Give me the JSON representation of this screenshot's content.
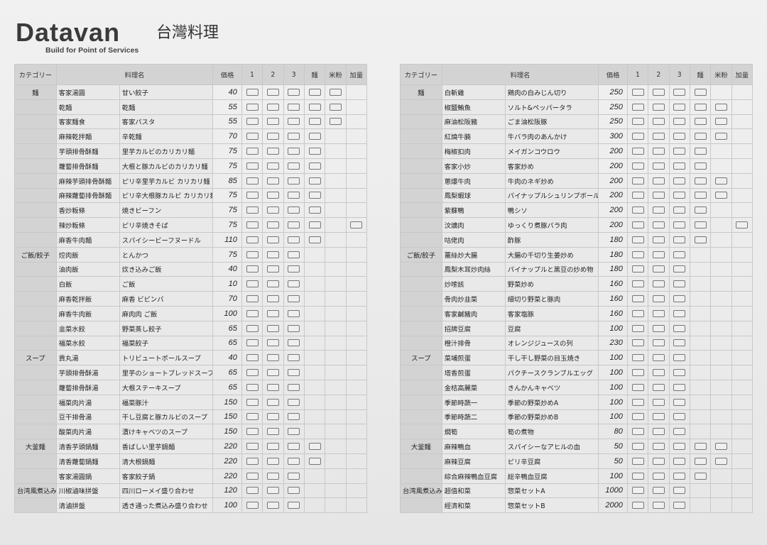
{
  "header": {
    "logo_text": "Datavan",
    "tagline": "Build for Point of Services",
    "title": "台灣料理"
  },
  "columns": {
    "category": "カテゴリー",
    "dish": "料理名",
    "price": "価格",
    "opt1": "1",
    "opt2": "2",
    "opt3": "3",
    "noodle": "麵",
    "rice_noodle": "米粉",
    "extra": "加量"
  },
  "left_table": {
    "rows": [
      {
        "cat": "麵",
        "name": "客家湯圓",
        "desc": "甘い餃子",
        "price": "40",
        "boxes": [
          1,
          1,
          1,
          1,
          1,
          0
        ]
      },
      {
        "cat": "",
        "name": "乾麵",
        "desc": "乾麵",
        "price": "55",
        "boxes": [
          1,
          1,
          1,
          1,
          1,
          0
        ]
      },
      {
        "cat": "",
        "name": "客家麵食",
        "desc": "客家パスタ",
        "price": "55",
        "boxes": [
          1,
          1,
          1,
          1,
          1,
          0
        ]
      },
      {
        "cat": "",
        "name": "麻辣乾拌麵",
        "desc": "辛乾麵",
        "price": "70",
        "boxes": [
          1,
          1,
          1,
          1,
          0,
          0
        ]
      },
      {
        "cat": "",
        "name": "芋頭排骨酥麵",
        "desc": "里芋カルビのカリカリ麺",
        "price": "75",
        "boxes": [
          1,
          1,
          1,
          1,
          0,
          0
        ]
      },
      {
        "cat": "",
        "name": "蘿蔔排骨酥麵",
        "desc": "大根と豚カルビのカリカリ麺",
        "price": "75",
        "boxes": [
          1,
          1,
          1,
          1,
          0,
          0
        ]
      },
      {
        "cat": "",
        "name": "麻辣芋頭排骨酥麵",
        "desc": "ピリ辛里芋カルビ カリカリ麺",
        "price": "85",
        "boxes": [
          1,
          1,
          1,
          1,
          0,
          0
        ]
      },
      {
        "cat": "",
        "name": "麻辣蘿蔔排骨酥麵",
        "desc": "ピリ辛大根豚カルビ カリカリ麺",
        "price": "75",
        "boxes": [
          1,
          1,
          1,
          1,
          0,
          0
        ]
      },
      {
        "cat": "",
        "name": "香炒粄條",
        "desc": "焼きビーフン",
        "price": "75",
        "boxes": [
          1,
          1,
          1,
          1,
          0,
          0
        ]
      },
      {
        "cat": "",
        "name": "辣炒粄條",
        "desc": "ピリ辛焼きそば",
        "price": "75",
        "boxes": [
          1,
          1,
          1,
          1,
          0,
          1
        ]
      },
      {
        "cat": "",
        "name": "麻香牛肉麵",
        "desc": "スパイシービーフヌードル",
        "price": "110",
        "boxes": [
          1,
          1,
          1,
          1,
          0,
          0
        ]
      },
      {
        "cat": "ご飯/餃子",
        "name": "焢肉飯",
        "desc": "とんかつ",
        "price": "75",
        "boxes": [
          1,
          1,
          1,
          0,
          0,
          0
        ]
      },
      {
        "cat": "",
        "name": "油肉飯",
        "desc": "炊き込みご飯",
        "price": "40",
        "boxes": [
          1,
          1,
          1,
          0,
          0,
          0
        ]
      },
      {
        "cat": "",
        "name": "白飯",
        "desc": "ご飯",
        "price": "10",
        "boxes": [
          1,
          1,
          1,
          0,
          0,
          0
        ]
      },
      {
        "cat": "",
        "name": "麻香乾拌飯",
        "desc": "麻香 ビビンバ",
        "price": "70",
        "boxes": [
          1,
          1,
          1,
          0,
          0,
          0
        ]
      },
      {
        "cat": "",
        "name": "麻香牛肉飯",
        "desc": "麻肉肉 ご飯",
        "price": "100",
        "boxes": [
          1,
          1,
          1,
          0,
          0,
          0
        ]
      },
      {
        "cat": "",
        "name": "韭菜水餃",
        "desc": "野菜蒸し餃子",
        "price": "65",
        "boxes": [
          1,
          1,
          1,
          0,
          0,
          0
        ]
      },
      {
        "cat": "",
        "name": "福菜水餃",
        "desc": "福菜餃子",
        "price": "65",
        "boxes": [
          1,
          1,
          1,
          0,
          0,
          0
        ]
      },
      {
        "cat": "スープ",
        "name": "貢丸湯",
        "desc": "トリビュートボールスープ",
        "price": "40",
        "boxes": [
          1,
          1,
          1,
          0,
          0,
          0
        ]
      },
      {
        "cat": "",
        "name": "芋頭排骨酥湯",
        "desc": "里芋のショートブレッドスープ",
        "price": "65",
        "boxes": [
          1,
          1,
          1,
          0,
          0,
          0
        ]
      },
      {
        "cat": "",
        "name": "蘿蔔排骨酥湯",
        "desc": "大根ステーキスープ",
        "price": "65",
        "boxes": [
          1,
          1,
          1,
          0,
          0,
          0
        ]
      },
      {
        "cat": "",
        "name": "福菜肉片湯",
        "desc": "福菜豚汁",
        "price": "150",
        "boxes": [
          1,
          1,
          1,
          0,
          0,
          0
        ]
      },
      {
        "cat": "",
        "name": "豆干排骨湯",
        "desc": "干し豆腐と豚カルビのスープ",
        "price": "150",
        "boxes": [
          1,
          1,
          1,
          0,
          0,
          0
        ]
      },
      {
        "cat": "",
        "name": "酸菜肉片湯",
        "desc": "漬けキャベツのスープ",
        "price": "150",
        "boxes": [
          1,
          1,
          1,
          0,
          0,
          0
        ]
      },
      {
        "cat": "大釜麵",
        "name": "清香芋頭鍋麵",
        "desc": "香ばしい里芋鍋麺",
        "price": "220",
        "boxes": [
          1,
          1,
          1,
          1,
          0,
          0
        ]
      },
      {
        "cat": "",
        "name": "清香蘿蔔鍋麵",
        "desc": "清大根鍋麺",
        "price": "220",
        "boxes": [
          1,
          1,
          1,
          1,
          0,
          0
        ]
      },
      {
        "cat": "",
        "name": "客家湯圓鍋",
        "desc": "客家餃子鍋",
        "price": "220",
        "boxes": [
          1,
          1,
          1,
          0,
          0,
          0
        ]
      },
      {
        "cat": "台湾風煮込み",
        "name": "川椒滷味拼盤",
        "desc": "四川ローメイ盛り合わせ",
        "price": "120",
        "boxes": [
          1,
          1,
          1,
          0,
          0,
          0
        ]
      },
      {
        "cat": "",
        "name": "清滷拼盤",
        "desc": "透き通った煮込み盛り合わせ",
        "price": "100",
        "boxes": [
          1,
          1,
          1,
          0,
          0,
          0
        ]
      }
    ]
  },
  "right_table": {
    "rows": [
      {
        "cat": "麵",
        "name": "白斬雞",
        "desc": "鶏肉の白みじん切り",
        "price": "250",
        "boxes": [
          1,
          1,
          1,
          1,
          0,
          0
        ]
      },
      {
        "cat": "",
        "name": "椒鹽鮪魚",
        "desc": "ソルト&ペッパータラ",
        "price": "250",
        "boxes": [
          1,
          1,
          1,
          1,
          1,
          0
        ]
      },
      {
        "cat": "",
        "name": "麻油松阪豬",
        "desc": "ごま油松阪豚",
        "price": "250",
        "boxes": [
          1,
          1,
          1,
          1,
          1,
          0
        ]
      },
      {
        "cat": "",
        "name": "紅燒牛腩",
        "desc": "牛バラ肉のあんかけ",
        "price": "300",
        "boxes": [
          1,
          1,
          1,
          1,
          1,
          0
        ]
      },
      {
        "cat": "",
        "name": "梅椒扣肉",
        "desc": "メイガンコウロウ",
        "price": "200",
        "boxes": [
          1,
          1,
          1,
          1,
          0,
          0
        ]
      },
      {
        "cat": "",
        "name": "客家小炒",
        "desc": "客家炒め",
        "price": "200",
        "boxes": [
          1,
          1,
          1,
          1,
          0,
          0
        ]
      },
      {
        "cat": "",
        "name": "蔥爆牛肉",
        "desc": "牛肉のネギ炒め",
        "price": "200",
        "boxes": [
          1,
          1,
          1,
          1,
          1,
          0
        ]
      },
      {
        "cat": "",
        "name": "鳳梨蝦球",
        "desc": "パイナップルシュリンプボール",
        "price": "200",
        "boxes": [
          1,
          1,
          1,
          1,
          1,
          0
        ]
      },
      {
        "cat": "",
        "name": "紫蘇鴨",
        "desc": "鴨シソ",
        "price": "200",
        "boxes": [
          1,
          1,
          1,
          1,
          0,
          0
        ]
      },
      {
        "cat": "",
        "name": "汶爌肉",
        "desc": "ゆっくり煮豚バラ肉",
        "price": "200",
        "boxes": [
          1,
          1,
          1,
          1,
          0,
          1
        ]
      },
      {
        "cat": "",
        "name": "咕佬肉",
        "desc": "酢豚",
        "price": "180",
        "boxes": [
          1,
          1,
          1,
          1,
          0,
          0
        ]
      },
      {
        "cat": "ご飯/餃子",
        "name": "薑絲炒大腸",
        "desc": "大腸の千切り生姜炒め",
        "price": "180",
        "boxes": [
          1,
          1,
          1,
          0,
          0,
          0
        ]
      },
      {
        "cat": "",
        "name": "鳳梨木耳炒肉絲",
        "desc": "パイナップルと黒豆の炒め物",
        "price": "180",
        "boxes": [
          1,
          1,
          1,
          0,
          0,
          0
        ]
      },
      {
        "cat": "",
        "name": "炒嗦該",
        "desc": "野菜炒め",
        "price": "160",
        "boxes": [
          1,
          1,
          1,
          0,
          0,
          0
        ]
      },
      {
        "cat": "",
        "name": "骨肉炒韭菜",
        "desc": "細切り野菜と豚肉",
        "price": "160",
        "boxes": [
          1,
          1,
          1,
          0,
          0,
          0
        ]
      },
      {
        "cat": "",
        "name": "客家鹹豬肉",
        "desc": "客家塩豚",
        "price": "160",
        "boxes": [
          1,
          1,
          1,
          0,
          0,
          0
        ]
      },
      {
        "cat": "",
        "name": "招牌豆腐",
        "desc": "豆腐",
        "price": "100",
        "boxes": [
          1,
          1,
          1,
          0,
          0,
          0
        ]
      },
      {
        "cat": "",
        "name": "橙汁排骨",
        "desc": "オレンジジュースの列",
        "price": "230",
        "boxes": [
          1,
          1,
          1,
          0,
          0,
          0
        ]
      },
      {
        "cat": "スープ",
        "name": "菜埔煎蛋",
        "desc": "干し干し野菜の目玉焼き",
        "price": "100",
        "boxes": [
          1,
          1,
          1,
          0,
          0,
          0
        ]
      },
      {
        "cat": "",
        "name": "塔香煎蛋",
        "desc": "パクチースクランブルエッグ",
        "price": "100",
        "boxes": [
          1,
          1,
          1,
          0,
          0,
          0
        ]
      },
      {
        "cat": "",
        "name": "金桔高麗菜",
        "desc": "きんかんキャベツ",
        "price": "100",
        "boxes": [
          1,
          1,
          1,
          0,
          0,
          0
        ]
      },
      {
        "cat": "",
        "name": "季節時蔬一",
        "desc": "季節の野菜炒めA",
        "price": "100",
        "boxes": [
          1,
          1,
          1,
          0,
          0,
          0
        ]
      },
      {
        "cat": "",
        "name": "季節時蔬二",
        "desc": "季節の野菜炒めB",
        "price": "100",
        "boxes": [
          1,
          1,
          1,
          0,
          0,
          0
        ]
      },
      {
        "cat": "",
        "name": "燜筍",
        "desc": "筍の煮物",
        "price": "80",
        "boxes": [
          1,
          1,
          1,
          0,
          0,
          0
        ]
      },
      {
        "cat": "大釜麵",
        "name": "麻辣鴨血",
        "desc": "スパイシーなアヒルの血",
        "price": "50",
        "boxes": [
          1,
          1,
          1,
          1,
          1,
          0
        ]
      },
      {
        "cat": "",
        "name": "麻辣豆腐",
        "desc": "ピリ辛豆腐",
        "price": "50",
        "boxes": [
          1,
          1,
          1,
          1,
          1,
          0
        ]
      },
      {
        "cat": "",
        "name": "綜合麻辣鴨血豆腐",
        "desc": "総辛鴨血豆腐",
        "price": "100",
        "boxes": [
          1,
          1,
          1,
          1,
          0,
          0
        ]
      },
      {
        "cat": "台湾風煮込み",
        "name": "超值和菜",
        "desc": "惣菜セットA",
        "price": "1000",
        "boxes": [
          1,
          1,
          1,
          0,
          0,
          0
        ]
      },
      {
        "cat": "",
        "name": "經濟和菜",
        "desc": "惣菜セットB",
        "price": "2000",
        "boxes": [
          1,
          1,
          1,
          0,
          0,
          0
        ]
      }
    ]
  }
}
